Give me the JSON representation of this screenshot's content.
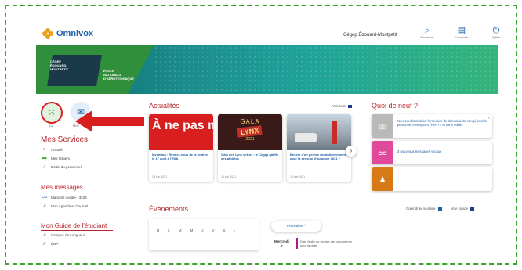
{
  "header": {
    "logo_text": "Omnivox",
    "college_name": "Cégep Édouard-Montpetit",
    "icons": [
      {
        "icon": "search-icon",
        "label": "Recherche"
      },
      {
        "icon": "dossier-icon",
        "label": "Connexion"
      },
      {
        "icon": "power-icon",
        "label": "Quitter"
      }
    ]
  },
  "banner": {
    "left_text": "CÉGEP\nÉDOUARD-\nMONTPETIT",
    "right_text": "ÉCOLE\nNATIONALE\nD'AÉROTECHNIQUE"
  },
  "quick": {
    "apps_label": "Lia",
    "mail_label": "MIO"
  },
  "mes_services": {
    "title": "Mes Services",
    "items": [
      {
        "icon": "home-icon",
        "label": "Accueil"
      },
      {
        "icon": "folder-icon",
        "label": "Mes fichiers"
      },
      {
        "icon": "external-link-icon",
        "label": "Bottin du personnel"
      }
    ]
  },
  "mes_messages": {
    "title": "Mes messages",
    "items": [
      {
        "icon": "voicemail-icon",
        "label": "Ma boîte vocale - 3224"
      },
      {
        "icon": "external-link-icon",
        "label": "Mon Agenda et Courriel"
      }
    ]
  },
  "guide": {
    "title": "Mon Guide de l'étudiant",
    "items": [
      {
        "icon": "external-link-icon",
        "label": "Campus de Longueuil"
      },
      {
        "icon": "external-link-icon",
        "label": "ÉNA"
      }
    ]
  },
  "actualites": {
    "title": "Actualités",
    "voir_tout": "Voir tout",
    "cards": [
      {
        "image_text": "À ne pas manquer",
        "title": "Invitation : Rendez-vous de la rentrée le 17 août à l'ÉNA",
        "date": "23 juin 2021"
      },
      {
        "image_text": "GALA",
        "image_badge": "LYNX",
        "image_year": "2021",
        "title": "Gala des Lynx virtuel : le Cégep gâtifie ses athlètes",
        "date": "18 juin 2021"
      },
      {
        "image_text": "",
        "title": "Besoin d'un permis de stationnement pour la session d'automne 2021 ?",
        "date": "15 juin 2021"
      }
    ],
    "next_arrow": "›"
  },
  "quoi_de_neuf": {
    "title": "Quoi de neuf ?",
    "items": [
      {
        "icon": "document-icon",
        "color": "#b9b9b9",
        "text": "Nouveau formulaire: formulaire de demande de congé pour le personnel enseignant (PVRTT et sans solde)"
      },
      {
        "icon": "voicemail-icon",
        "color": "#e04a9a",
        "text": "3 nouveaux messages vocaux"
      },
      {
        "icon": "user-icon",
        "color": "#d67a18",
        "text": ""
      }
    ]
  },
  "evenements": {
    "title": "Évènements",
    "calendar_link": "Calendrier scolaire",
    "view_link": "Vue rapide",
    "day_names": [
      "D",
      "L",
      "M",
      "M",
      "J",
      "V",
      "S"
    ],
    "precedent": "Précédent  ^",
    "event_day": "Mercredi",
    "event_day_num": "7",
    "event_text": "Date limite de remise des documents",
    "event_text2": "pour la date..."
  },
  "colors": {
    "accent_red": "#b7262a",
    "brand_blue": "#1d5fa8",
    "callout": "#d81e1e"
  }
}
